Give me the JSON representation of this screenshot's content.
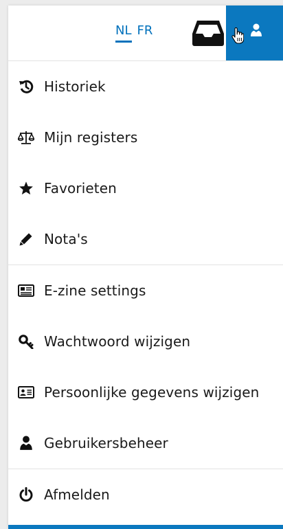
{
  "header": {
    "languages": [
      {
        "code": "NL",
        "active": true
      },
      {
        "code": "FR",
        "active": false
      }
    ],
    "accent_color": "#0b78bf",
    "inbox_icon": "inbox-icon",
    "user_icon": "user-icon"
  },
  "menu": {
    "group1": [
      {
        "label": "Historiek",
        "icon": "history-icon"
      },
      {
        "label": "Mijn registers",
        "icon": "scales-icon"
      },
      {
        "label": "Favorieten",
        "icon": "star-icon"
      },
      {
        "label": "Nota's",
        "icon": "pencil-icon"
      }
    ],
    "group2": [
      {
        "label": "E-zine settings",
        "icon": "newspaper-icon"
      },
      {
        "label": "Wachtwoord wijzigen",
        "icon": "key-icon"
      },
      {
        "label": "Persoonlijke gegevens wijzigen",
        "icon": "id-card-icon"
      },
      {
        "label": "Gebruikersbeheer",
        "icon": "user-icon"
      }
    ],
    "group3": [
      {
        "label": "Afmelden",
        "icon": "power-icon"
      }
    ]
  }
}
